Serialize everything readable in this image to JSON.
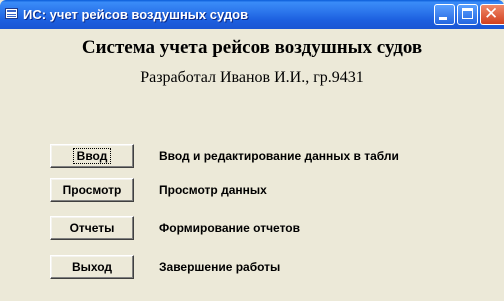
{
  "window": {
    "title": "ИС: учет рейсов воздушных судов",
    "icon": "app-form-icon",
    "controls": [
      "minimize-icon",
      "maximize-icon",
      "close-icon"
    ]
  },
  "main": {
    "heading": "Система учета рейсов воздушных судов",
    "subheading": "Разработал Иванов И.И., гр.9431"
  },
  "menu": [
    {
      "label": "Ввод",
      "description": "Ввод и редактирование данных в табли"
    },
    {
      "label": "Просмотр",
      "description": "Просмотр данных"
    },
    {
      "label": "Отчеты",
      "description": "Формирование отчетов"
    },
    {
      "label": "Выход",
      "description": "Завершение работы"
    }
  ],
  "colors": {
    "titlebar": "#2C76EC",
    "window_bg": "#ECE9D8",
    "close_button": "#D2401E"
  }
}
